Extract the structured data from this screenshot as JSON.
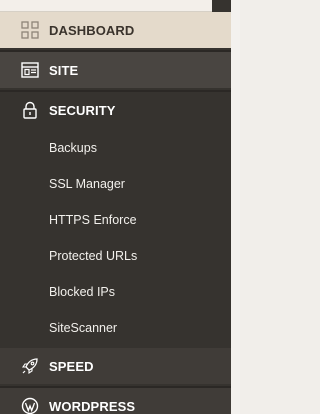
{
  "menu": {
    "dashboard": {
      "label": "DASHBOARD",
      "icon": "grid-icon"
    },
    "site": {
      "label": "SITE",
      "icon": "browser-window-icon"
    },
    "security": {
      "label": "SECURITY",
      "icon": "lock-icon"
    },
    "speed": {
      "label": "SPEED",
      "icon": "rocket-icon"
    },
    "wordpress": {
      "label": "WORDPRESS",
      "icon": "wordpress-icon"
    }
  },
  "security_submenu": [
    {
      "label": "Backups"
    },
    {
      "label": "SSL Manager"
    },
    {
      "label": "HTTPS Enforce"
    },
    {
      "label": "Protected URLs"
    },
    {
      "label": "Blocked IPs"
    },
    {
      "label": "SiteScanner"
    }
  ],
  "colors": {
    "sidebar_bg": "#36332f",
    "active_item_bg": "#e4dacb",
    "hover_item_bg": "#494541",
    "text_light": "#ffffff"
  }
}
